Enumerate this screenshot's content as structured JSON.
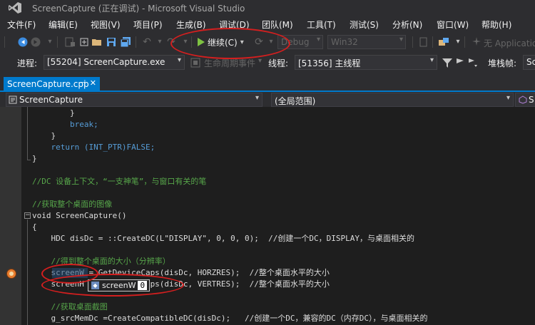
{
  "window": {
    "title": "ScreenCapture (正在调试) - Microsoft Visual Studio"
  },
  "menu": {
    "items": [
      "文件(F)",
      "编辑(E)",
      "视图(V)",
      "项目(P)",
      "生成(B)",
      "调试(D)",
      "团队(M)",
      "工具(T)",
      "测试(S)",
      "分析(N)",
      "窗口(W)",
      "帮助(H)"
    ]
  },
  "toolbar": {
    "continue_label": "继续(C)",
    "config": "Debug",
    "platform": "Win32",
    "no_application": "无 Application",
    "icons": [
      "back-icon",
      "forward-icon",
      "new-project-icon",
      "open-icon",
      "save-icon",
      "save-all-icon",
      "undo-icon",
      "redo-icon",
      "play-icon",
      "restart-icon"
    ]
  },
  "debug_location": {
    "process_label": "进程:",
    "process_value": "[55204] ScreenCapture.exe",
    "lifecycle_label": "生命周期事件",
    "thread_label": "线程:",
    "thread_value": "[51356] 主线程",
    "stack_label": "堆栈帧:",
    "stack_value": "Sc"
  },
  "tabs": [
    {
      "label": "ScreenCapture.cpp",
      "active": true
    }
  ],
  "navigation": {
    "project": "ScreenCapture",
    "scope": "(全局范围)",
    "member": "S"
  },
  "code": {
    "lines": [
      "        }",
      "        break;",
      "    }",
      "    return (INT_PTR)FALSE;",
      "}",
      "",
      "//DC 设备上下文，“一支神笔”，与窗口有关的笔",
      "",
      "//获取整个桌面的图像",
      "void ScreenCapture()",
      "{",
      "    HDC disDc = ::CreateDC(L\"DISPLAY\", 0, 0, 0);  //创建一个DC，DISPLAY，与桌面相关的",
      "",
      "    //得到整个桌面的大小（分辨率）",
      "    screenW = GetDeviceCaps(disDc, HORZRES);  //整个桌面水平的大小",
      "    screenH = GetDeviceCaps(disDc, VERTRES);  //整个桌面水平的大小",
      "",
      "    //获取桌面截图",
      "    g_srcMemDc =CreateCompatibleDC(disDc);   //创建一个DC，兼容的DC（内存DC），与桌面相关的"
    ],
    "current_line_index": 14
  },
  "datatip": {
    "name": "screenW",
    "value": "0"
  },
  "colors": {
    "accent": "#007acc",
    "annotation": "#d41f1f",
    "continue": "#7ec242",
    "breakpoint": "#e97d2e"
  }
}
